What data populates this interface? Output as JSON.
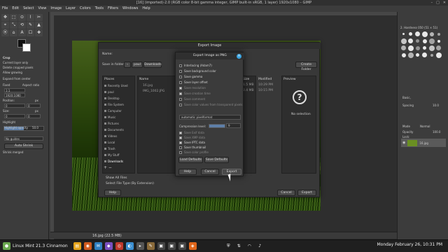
{
  "window": {
    "title": "[16] (imported)-2.0 (RGB color 8-bit gamma integer, GIMP built-in sRGB, 1 layer) 1920x1080 – GIMP"
  },
  "menubar": [
    "File",
    "Edit",
    "Select",
    "View",
    "Image",
    "Layer",
    "Colors",
    "Tools",
    "Filters",
    "Windows",
    "Help"
  ],
  "toolbox": {
    "tools": [
      "✥",
      "⬚",
      "⊙",
      "⌇",
      "✂",
      "⌖",
      "⤡",
      "⟲",
      "✎",
      "▲",
      "⦿",
      "⌂",
      "A",
      "☐",
      "✚"
    ],
    "options": {
      "section": "Crop",
      "current_layer_only": "Current layer only",
      "delete_cropped": "Delete cropped pixels",
      "allow_growing": "Allow growing",
      "expand_from_center": "Expand from center",
      "fixed": "Fixed",
      "aspect_ratio": "Aspect ratio",
      "ratio_value": "1:1",
      "size_value": "1920:1080",
      "position_label": "Position:",
      "px": "px",
      "pos_x": "0",
      "pos_y": "0",
      "size_label": "Size:",
      "size_w": "0",
      "size_h": "0",
      "highlight": "Highlight",
      "highlight_opacity": "Highlight opacity",
      "highlight_value": "50.0",
      "no_guides": "No guides",
      "auto_shrink": "Auto Shrink",
      "shrink_merged": "Shrink merged"
    }
  },
  "status": {
    "file": "16.jpg (22.5 MB)"
  },
  "export": {
    "title": "Export Image",
    "name_label": "Name:",
    "save_in_label": "Save in folder:",
    "path_user": "paul",
    "path_folder": "Downloads",
    "create_folder": "Create Folder",
    "places_header": "Places",
    "name_header": "Name",
    "size_header": "Size",
    "modified_header": "Modified",
    "preview_header": "Preview",
    "no_selection": "No selection",
    "files": [
      {
        "name": "16.jpg",
        "size": "1.5 MB",
        "modified": "10:29 PM"
      },
      {
        "name": "IMG_1002.JPG",
        "size": "2.4 MB",
        "modified": "10:15 PM"
      }
    ],
    "places": [
      "Recently Used",
      "paul",
      "Desktop",
      "File System",
      "Computer",
      "Music",
      "Pictures",
      "Documents",
      "Videos",
      "Local",
      "Trash",
      "My Stuff",
      "Downloads"
    ],
    "show_all_files": "Show All Files",
    "select_file_type": "Select File Type (By Extension)",
    "help": "Help",
    "cancel": "Cancel",
    "export": "Export"
  },
  "png": {
    "title": "Export Image as PNG",
    "options": [
      {
        "label": "Interlacing (Adam7)",
        "checked": false,
        "dim": false
      },
      {
        "label": "Save background color",
        "checked": false,
        "dim": false
      },
      {
        "label": "Save gamma",
        "checked": false,
        "dim": false
      },
      {
        "label": "Save layer offset",
        "checked": false,
        "dim": false
      },
      {
        "label": "Save resolution",
        "checked": true,
        "dim": true
      },
      {
        "label": "Save creation time",
        "checked": true,
        "dim": true
      },
      {
        "label": "Save comment",
        "checked": false,
        "dim": true
      },
      {
        "label": "Save color values from transparent pixels",
        "checked": false,
        "dim": true
      }
    ],
    "format": "automatic pixelformat",
    "compression_label": "Compression level:",
    "compression_value": "9",
    "meta": [
      {
        "label": "Save Exif data",
        "checked": true
      },
      {
        "label": "Save XMP data",
        "checked": true
      },
      {
        "label": "Save IPTC data",
        "checked": true
      },
      {
        "label": "Save thumbnail",
        "checked": false
      },
      {
        "label": "Save color profile",
        "checked": false
      }
    ],
    "load_defaults": "Load Defaults",
    "save_defaults": "Save Defaults",
    "help": "Help",
    "cancel": "Cancel",
    "export": "Export"
  },
  "dock": {
    "brush_name": "2. Hardness 050 (51 × 51)",
    "spacing_label": "Spacing",
    "spacing_value": "10.0",
    "brush_preset": "Basic,",
    "mode_label": "Mode",
    "mode_value": "Normal",
    "opacity_label": "Opacity",
    "opacity_value": "100.0",
    "lock_label": "Lock:",
    "layer_name": "16.jpg"
  },
  "taskbar": {
    "os": "Linux Mint 21.3 Cinnamon",
    "clock": "Monday February 26, 10:31 PM"
  }
}
